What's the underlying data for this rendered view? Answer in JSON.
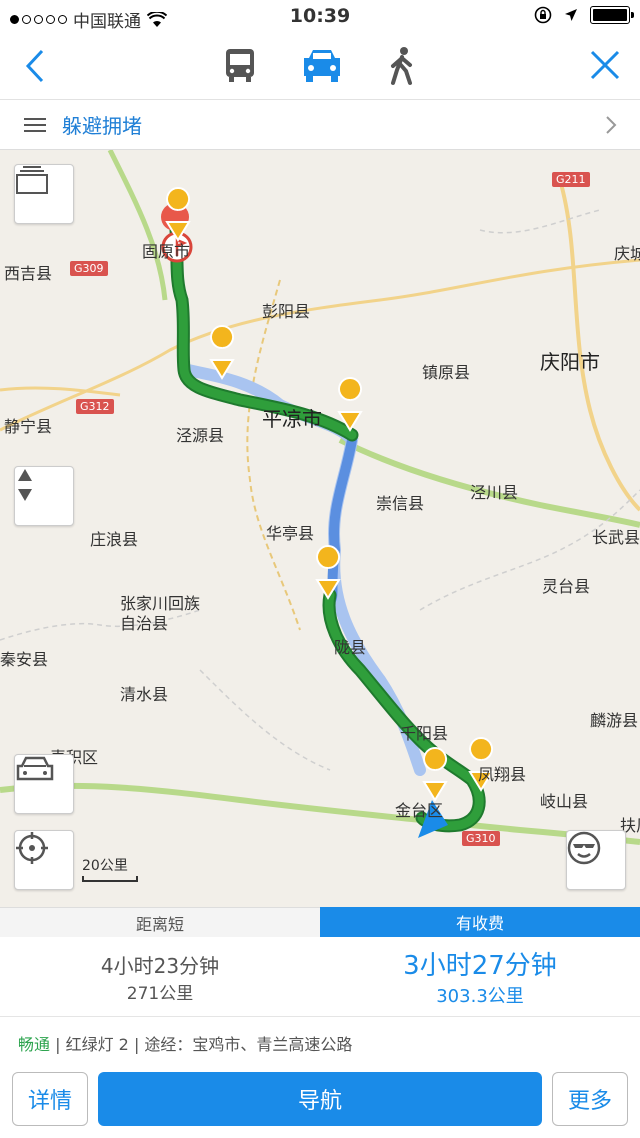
{
  "status_bar": {
    "carrier": "中国联通",
    "time": "10:39"
  },
  "mode_bar": {
    "modes": [
      "bus-icon",
      "car-icon",
      "walk-icon"
    ],
    "active_mode": "car",
    "accent": "#1a8be8"
  },
  "avoid_bar": {
    "label": "躲避拥堵"
  },
  "map": {
    "places": {
      "guyuan": "固原市",
      "xiji": "西吉县",
      "pengyang": "彭阳县",
      "zhenyuan": "镇原县",
      "qingyang": "庆阳市",
      "qingcheng": "庆城",
      "jingning": "静宁县",
      "jingyuan": "泾源县",
      "pingliang": "平凉市",
      "chongxin": "崇信县",
      "jingchuan": "泾川县",
      "zhuanglang": "庄浪县",
      "huating": "华亭县",
      "changwu": "长武县",
      "lingtai": "灵台县",
      "zhangjiachuan_1": "张家川回族",
      "zhangjiachuan_2": "自治县",
      "qinan": "秦安县",
      "longxian": "陇县",
      "qingshui": "清水县",
      "linyou": "麟游县",
      "qianyang": "千阳县",
      "fengxiang": "凤翔县",
      "maiji": "麦积区",
      "jintai": "金台区",
      "qishan": "岐山县",
      "fufeng": "扶风"
    },
    "highways": {
      "g211": "G211",
      "g309": "G309",
      "g312": "G312",
      "g310": "G310"
    },
    "scale": "20公里",
    "route_main_color": "#2f9e3b",
    "route_alt_color": "#5b8fe0"
  },
  "tabs": {
    "shortest": "距离短",
    "toll": "有收费"
  },
  "routes": {
    "alt": {
      "duration": "4小时23分钟",
      "distance": "271公里"
    },
    "main": {
      "duration": "3小时27分钟",
      "distance": "303.3公里"
    }
  },
  "route_info": {
    "traffic": "畅通",
    "details": "| 红绿灯 2 | 途经：宝鸡市、青兰高速公路"
  },
  "buttons": {
    "details": "详情",
    "navigate": "导航",
    "more": "更多"
  }
}
